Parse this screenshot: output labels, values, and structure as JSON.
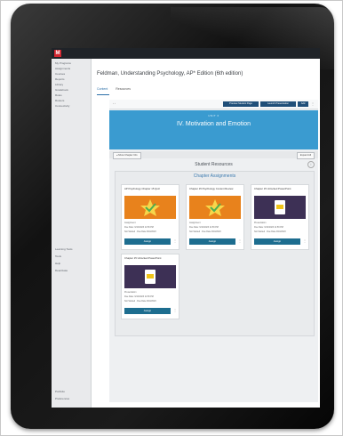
{
  "topbar": {
    "logo": "M"
  },
  "sidebar": {
    "top_items": [
      "My Programs",
      "Assignments",
      "Courses",
      "Reports",
      "Library",
      "Gradebook",
      "Roles",
      "Rosters",
      "Connectivity"
    ],
    "middle_items": [
      "Learning Tools",
      "Tools",
      "Help",
      "Deactivate"
    ],
    "bottom_items": [
      "Portfolio",
      "Preferences"
    ]
  },
  "course": {
    "title": "Feldman, Understanding Psychology, AP* Edition (6th edition)",
    "tabs": [
      "Content",
      "Resources"
    ]
  },
  "toolbar": {
    "left_label": "‹ ›",
    "buttons": [
      "Preview Student Page",
      "Launch Presentation",
      "Add"
    ]
  },
  "banner": {
    "kicker": "UNIT 6",
    "title": "IV. Motivation and Emotion"
  },
  "band": {
    "left_button": "◂ Show Chapter Info",
    "right_button": "Expand All"
  },
  "student_resources": {
    "title": "Student Resources",
    "icon": "info-icon"
  },
  "chapter_assignments": {
    "title": "Chapter Assignments",
    "cards": [
      {
        "title": "AP Psychology Chapter 15 Quiz",
        "art": "orange",
        "meta1": "Assignment",
        "meta2": "Due Date: 9/10/2023 11:59 PM",
        "meta3": "Not Started · Due Date 9/10/2023",
        "button": "Assign"
      },
      {
        "title": "Chapter 15 Psychology Content Review",
        "art": "orange",
        "meta1": "Assignment",
        "meta2": "Due Date: 9/10/2023 11:59 PM",
        "meta3": "Not Started · Due Date 9/10/2023",
        "button": "Assign"
      },
      {
        "title": "Chapter 15 Unlocked PowerPoint",
        "art": "purple",
        "meta1": "Presentation",
        "meta2": "Due Date: 9/10/2023 11:59 PM",
        "meta3": "Not Started · Due Date 9/10/2023",
        "button": "Assign"
      },
      {
        "title": "Chapter 15 Unlocked PowerPoint",
        "art": "purple",
        "meta1": "Presentation",
        "meta2": "Due Date: 9/10/2023 11:59 PM",
        "meta3": "Not Started · Due Date 9/10/2023",
        "button": "Assign"
      }
    ]
  },
  "colors": {
    "brand_red": "#d22630",
    "banner_blue": "#3a9bd0",
    "orange": "#e8821c",
    "purple": "#3d3055",
    "button_teal": "#1d6d8f"
  }
}
